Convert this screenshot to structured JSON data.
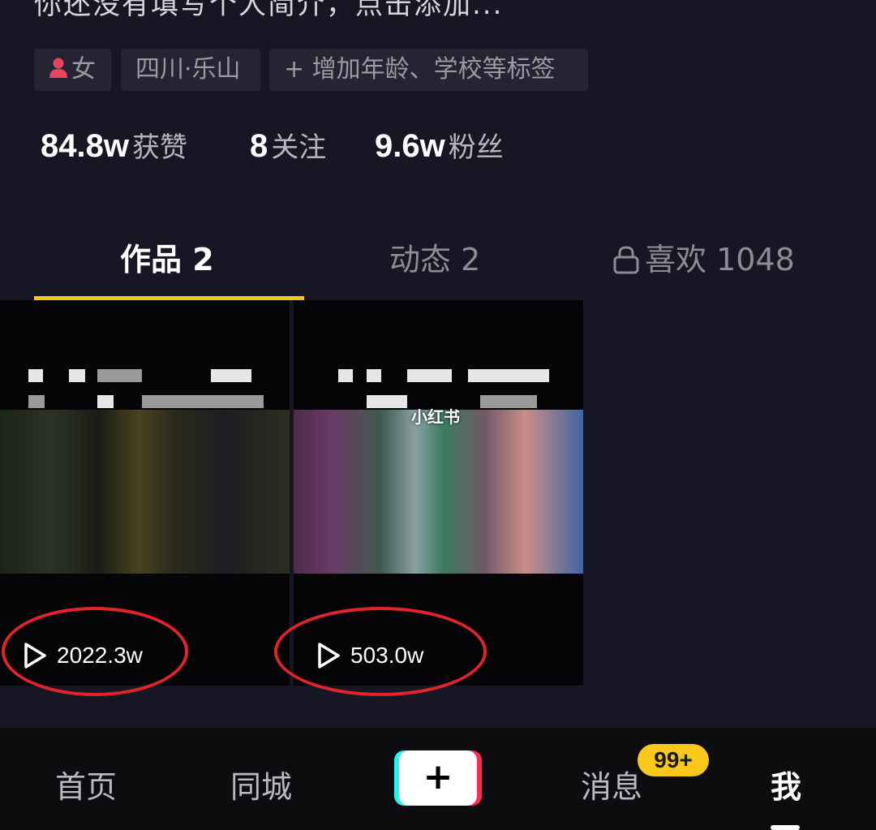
{
  "profile": {
    "bio_placeholder": "你还没有填写个人简介，点击添加...",
    "tags": {
      "gender_icon": "person-icon",
      "gender": "女",
      "location": "四川·乐山",
      "add_tags": "+ 增加年龄、学校等标签"
    },
    "stats": {
      "likes_count": "84.8w",
      "likes_label": "获赞",
      "following_count": "8",
      "following_label": "关注",
      "followers_count": "9.6w",
      "followers_label": "粉丝"
    }
  },
  "tabs": {
    "works": "作品 2",
    "dynamics": "动态 2",
    "likes_icon": "lock-icon",
    "likes": "喜欢 1048",
    "active": "works",
    "accent_color": "#f5c518"
  },
  "videos": [
    {
      "play_icon": "play-icon",
      "plays": "2022.3w"
    },
    {
      "play_icon": "play-icon",
      "plays": "503.0w",
      "watermark": "小红书"
    }
  ],
  "annotation": {
    "circle_color": "#e0242a"
  },
  "nav": {
    "home": "首页",
    "city": "同城",
    "add": "+",
    "messages": "消息",
    "messages_badge": "99+",
    "me": "我"
  }
}
